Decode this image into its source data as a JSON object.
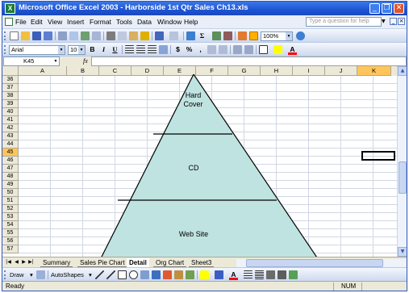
{
  "window": {
    "title": "Microsoft Office Excel 2003 - Harborside 1st Qtr Sales Ch13.xls",
    "app_icon": "excel-icon",
    "controls": [
      "minimize",
      "restore",
      "close"
    ]
  },
  "menubar": {
    "items": [
      "File",
      "Edit",
      "View",
      "Insert",
      "Format",
      "Tools",
      "Data",
      "Window",
      "Help"
    ],
    "help_placeholder": "Type a question for help"
  },
  "toolbar_formatting": {
    "font": "Arial",
    "size": "10",
    "bold": "B",
    "italic": "I",
    "underline": "U",
    "currency": "$",
    "percent": "%",
    "comma": ","
  },
  "toolbar_standard": {
    "zoom": "100%",
    "autosum": "Σ"
  },
  "formula_bar": {
    "name_box": "K45",
    "fx": "fx",
    "value": ""
  },
  "grid": {
    "columns": [
      "A",
      "B",
      "C",
      "D",
      "E",
      "F",
      "G",
      "H",
      "I",
      "J",
      "K"
    ],
    "selected_column": "K",
    "rows": [
      "36",
      "37",
      "38",
      "39",
      "40",
      "41",
      "42",
      "43",
      "44",
      "45",
      "46",
      "47",
      "48",
      "49",
      "50",
      "51",
      "52",
      "53",
      "54",
      "55",
      "56",
      "57"
    ],
    "selected_row": "45",
    "active_cell": "K45"
  },
  "pyramid": {
    "fill": "#bfe3e0",
    "stroke": "#000000",
    "levels": [
      "Hard Cover",
      "CD",
      "Web Site"
    ]
  },
  "sheet_tabs": {
    "tabs": [
      "Summary",
      "Sales Pie Chart",
      "Detail",
      "Org Chart",
      "Sheet3"
    ],
    "active": "Detail"
  },
  "drawing_toolbar": {
    "draw": "Draw",
    "autoshapes": "AutoShapes"
  },
  "status": {
    "text": "Ready",
    "num": "NUM"
  }
}
